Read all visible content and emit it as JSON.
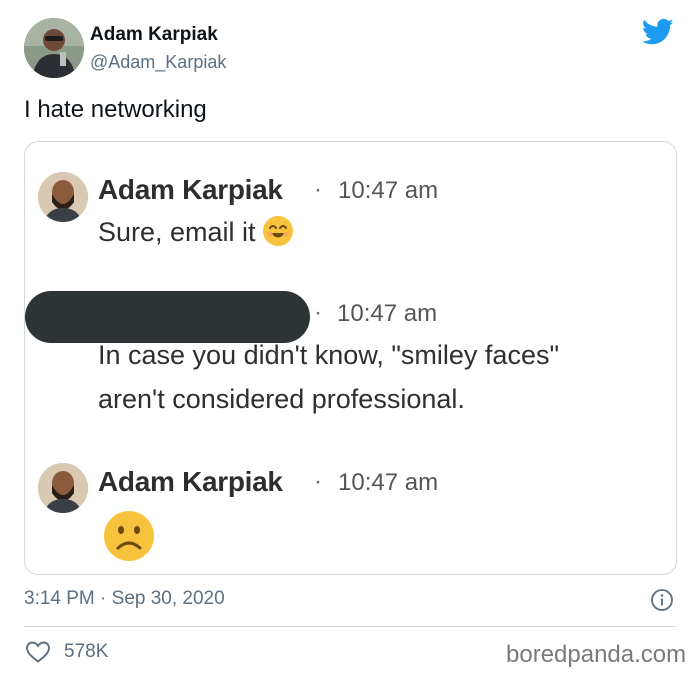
{
  "tweet": {
    "author_name": "Adam Karpiak",
    "author_handle": "@Adam_Karpiak",
    "text": "I hate networking",
    "timestamp": "3:14 PM · Sep 30, 2020",
    "like_count": "578K"
  },
  "screenshot": {
    "messages": [
      {
        "sender": "Adam Karpiak",
        "time": "10:47 am",
        "body": "Sure, email it",
        "emoji": "smiling-face-icon"
      },
      {
        "sender": "",
        "time": "10:47 am",
        "body_lines": [
          "In case you didn't know, \"smiley faces\"",
          "aren't considered professional."
        ]
      },
      {
        "sender": "Adam Karpiak",
        "time": "10:47 am",
        "emoji": "frowning-face-icon"
      }
    ]
  },
  "footer": {
    "watermark": "boredpanda.com"
  },
  "colors": {
    "twitter_blue": "#1d9bf0",
    "secondary_text": "#5b7083",
    "border": "#cfd9de",
    "redaction": "#2e3336"
  }
}
